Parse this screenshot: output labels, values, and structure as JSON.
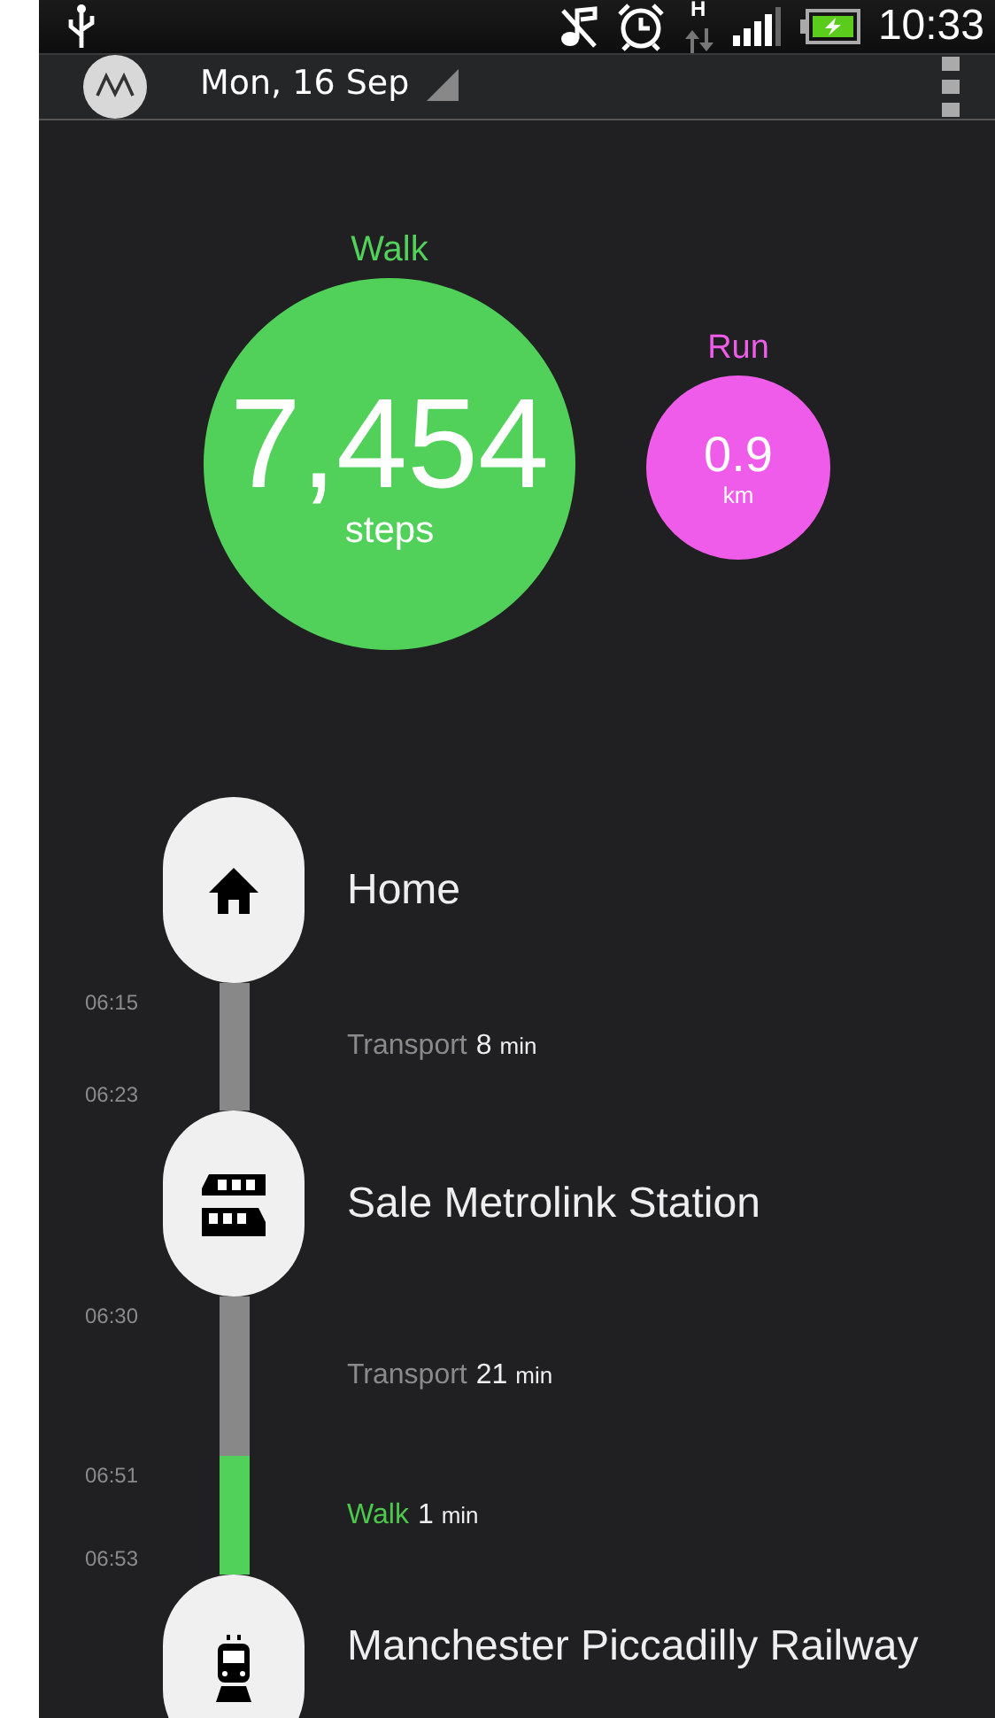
{
  "status_bar": {
    "network_type": "H",
    "time": "10:33"
  },
  "app_bar": {
    "date": "Mon, 16 Sep"
  },
  "activities": [
    {
      "kind": "walk",
      "label": "Walk",
      "value": "7,454",
      "unit": "steps"
    },
    {
      "kind": "run",
      "label": "Run",
      "value": "0.9",
      "unit": "km"
    }
  ],
  "timeline": [
    {
      "kind": "home",
      "name": "Home"
    },
    {
      "kind": "transport",
      "mode": "Transport",
      "duration": "8",
      "unit": "min",
      "start": "06:15",
      "end": "06:23"
    },
    {
      "kind": "tram",
      "name": "Sale Metrolink Station"
    },
    {
      "kind": "transport",
      "mode": "Transport",
      "duration": "21",
      "unit": "min",
      "start": "06:30"
    },
    {
      "kind": "walk",
      "mode": "Walk",
      "duration": "1",
      "unit": "min",
      "start": "06:51",
      "end": "06:53"
    },
    {
      "kind": "train",
      "name": "Manchester Piccadilly Railway"
    }
  ]
}
